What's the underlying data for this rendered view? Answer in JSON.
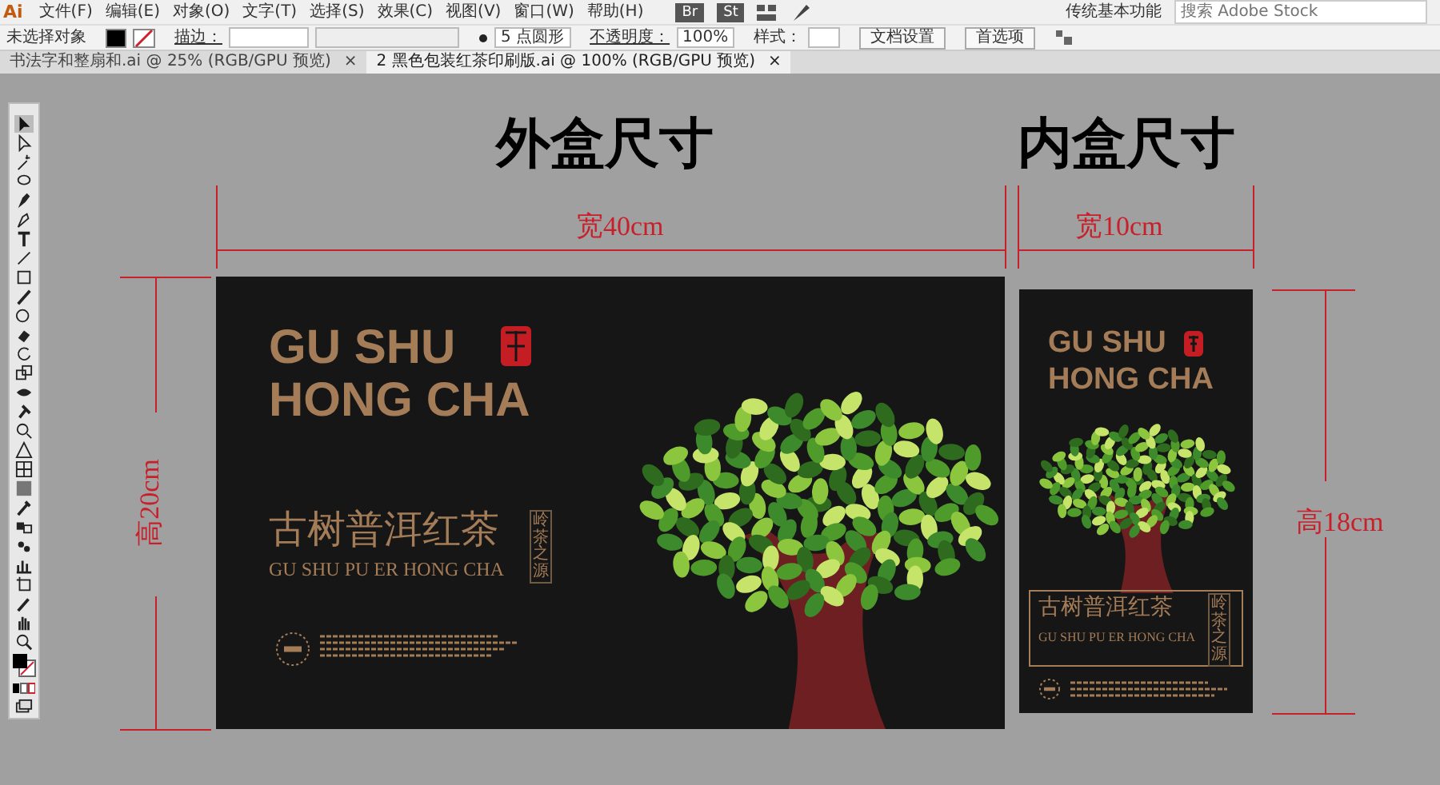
{
  "app": {
    "logo": "Ai",
    "menu": [
      "文件(F)",
      "编辑(E)",
      "对象(O)",
      "文字(T)",
      "选择(S)",
      "效果(C)",
      "视图(V)",
      "窗口(W)",
      "帮助(H)"
    ],
    "bridge_label": "Br",
    "stock_label": "St",
    "workspace": "传统基本功能",
    "search": {
      "placeholder": "搜索 Adobe Stock"
    }
  },
  "control_bar": {
    "selection": "未选择对象",
    "stroke_label": "描边：",
    "brush": "5 点圆形",
    "opacity_label": "不透明度：",
    "opacity": "100%",
    "style_label": "样式：",
    "buttons": [
      "文档设置",
      "首选项"
    ]
  },
  "tabs": [
    {
      "label": "书法字和整扇和.ai @ 25% (RGB/GPU 预览)",
      "close": "×",
      "selected": false
    },
    {
      "label": "2 黑色包装红茶印刷版.ai @ 100% (RGB/GPU 预览)",
      "close": "×",
      "selected": true
    }
  ],
  "canvas": {
    "outer_title": "外盒尺寸",
    "inner_title": "内盒尺寸",
    "outer_width": "宽40cm",
    "inner_width": "宽10cm",
    "outer_height": "高20cm",
    "inner_height": "高18cm",
    "outer_box": {
      "brand_line_1": "GU SHU",
      "brand_line_2": "HONG CHA",
      "chinese_name": "古树普洱红茶",
      "pinyin": "GU SHU PU ER HONG CHA",
      "vertical_tag": "岭茶之源"
    },
    "inner_box": {
      "brand_line_1": "GU SHU",
      "brand_line_2": "HONG CHA",
      "chinese_name": "古树普洱红茶",
      "pinyin": "GU SHU PU ER HONG CHA",
      "vertical_tag": "岭茶之源"
    }
  }
}
